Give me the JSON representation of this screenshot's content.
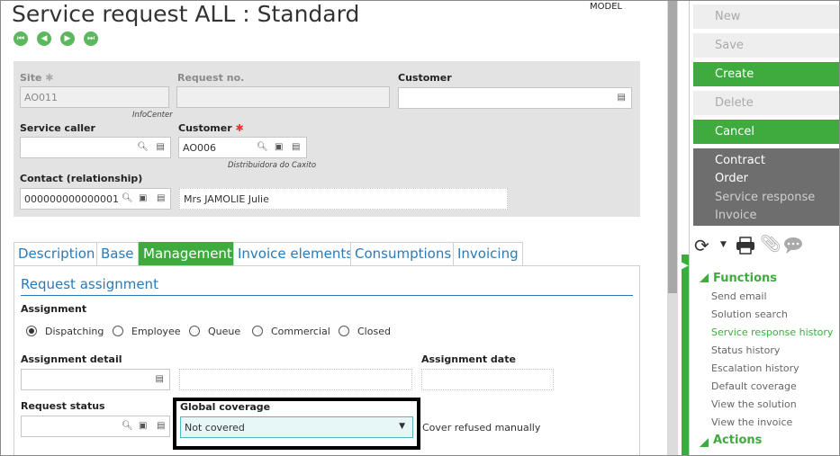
{
  "title": "Service request ALL : Standard",
  "model": "MODEL",
  "nav": {
    "first": "⏮",
    "prev": "◀",
    "next": "▶",
    "last": "⏭"
  },
  "header": {
    "site_label": "Site",
    "site_value": "AO011",
    "site_sub": "InfoCenter",
    "reqno_label": "Request no.",
    "customer_label": "Customer",
    "caller_label": "Service caller",
    "customer2_label": "Customer",
    "customer2_value": "AO006",
    "customer2_sub": "Distribuidora do Caxito",
    "contact_label": "Contact (relationship)",
    "contact_value": "000000000000001",
    "contact_name": "Mrs JAMOLIE Julie"
  },
  "tabs": [
    "Description",
    "Base",
    "Management",
    "Invoice elements",
    "Consumptions",
    "Invoicing"
  ],
  "section_title": "Request assignment",
  "assignment": {
    "label": "Assignment",
    "options": [
      "Dispatching",
      "Employee",
      "Queue",
      "Commercial",
      "Closed"
    ],
    "selected": "Dispatching"
  },
  "assignment_detail_label": "Assignment detail",
  "assignment_date_label": "Assignment date",
  "request_status_label": "Request status",
  "global_coverage": {
    "label": "Global coverage",
    "value": "Not covered"
  },
  "cover_refused": "Cover refused manually",
  "side": {
    "buttons": [
      "New",
      "Save",
      "Create",
      "Delete",
      "Cancel"
    ],
    "dark_items": [
      "Contract",
      "Order",
      "Service response",
      "Invoice"
    ],
    "functions_header": "Functions",
    "functions": [
      "Send email",
      "Solution search",
      "Service response history",
      "Status history",
      "Escalation history",
      "Default coverage",
      "View the solution",
      "View the invoice"
    ],
    "actions_header": "Actions"
  },
  "colors": {
    "accent": "#3fab3f",
    "link": "#2a7ab8"
  }
}
